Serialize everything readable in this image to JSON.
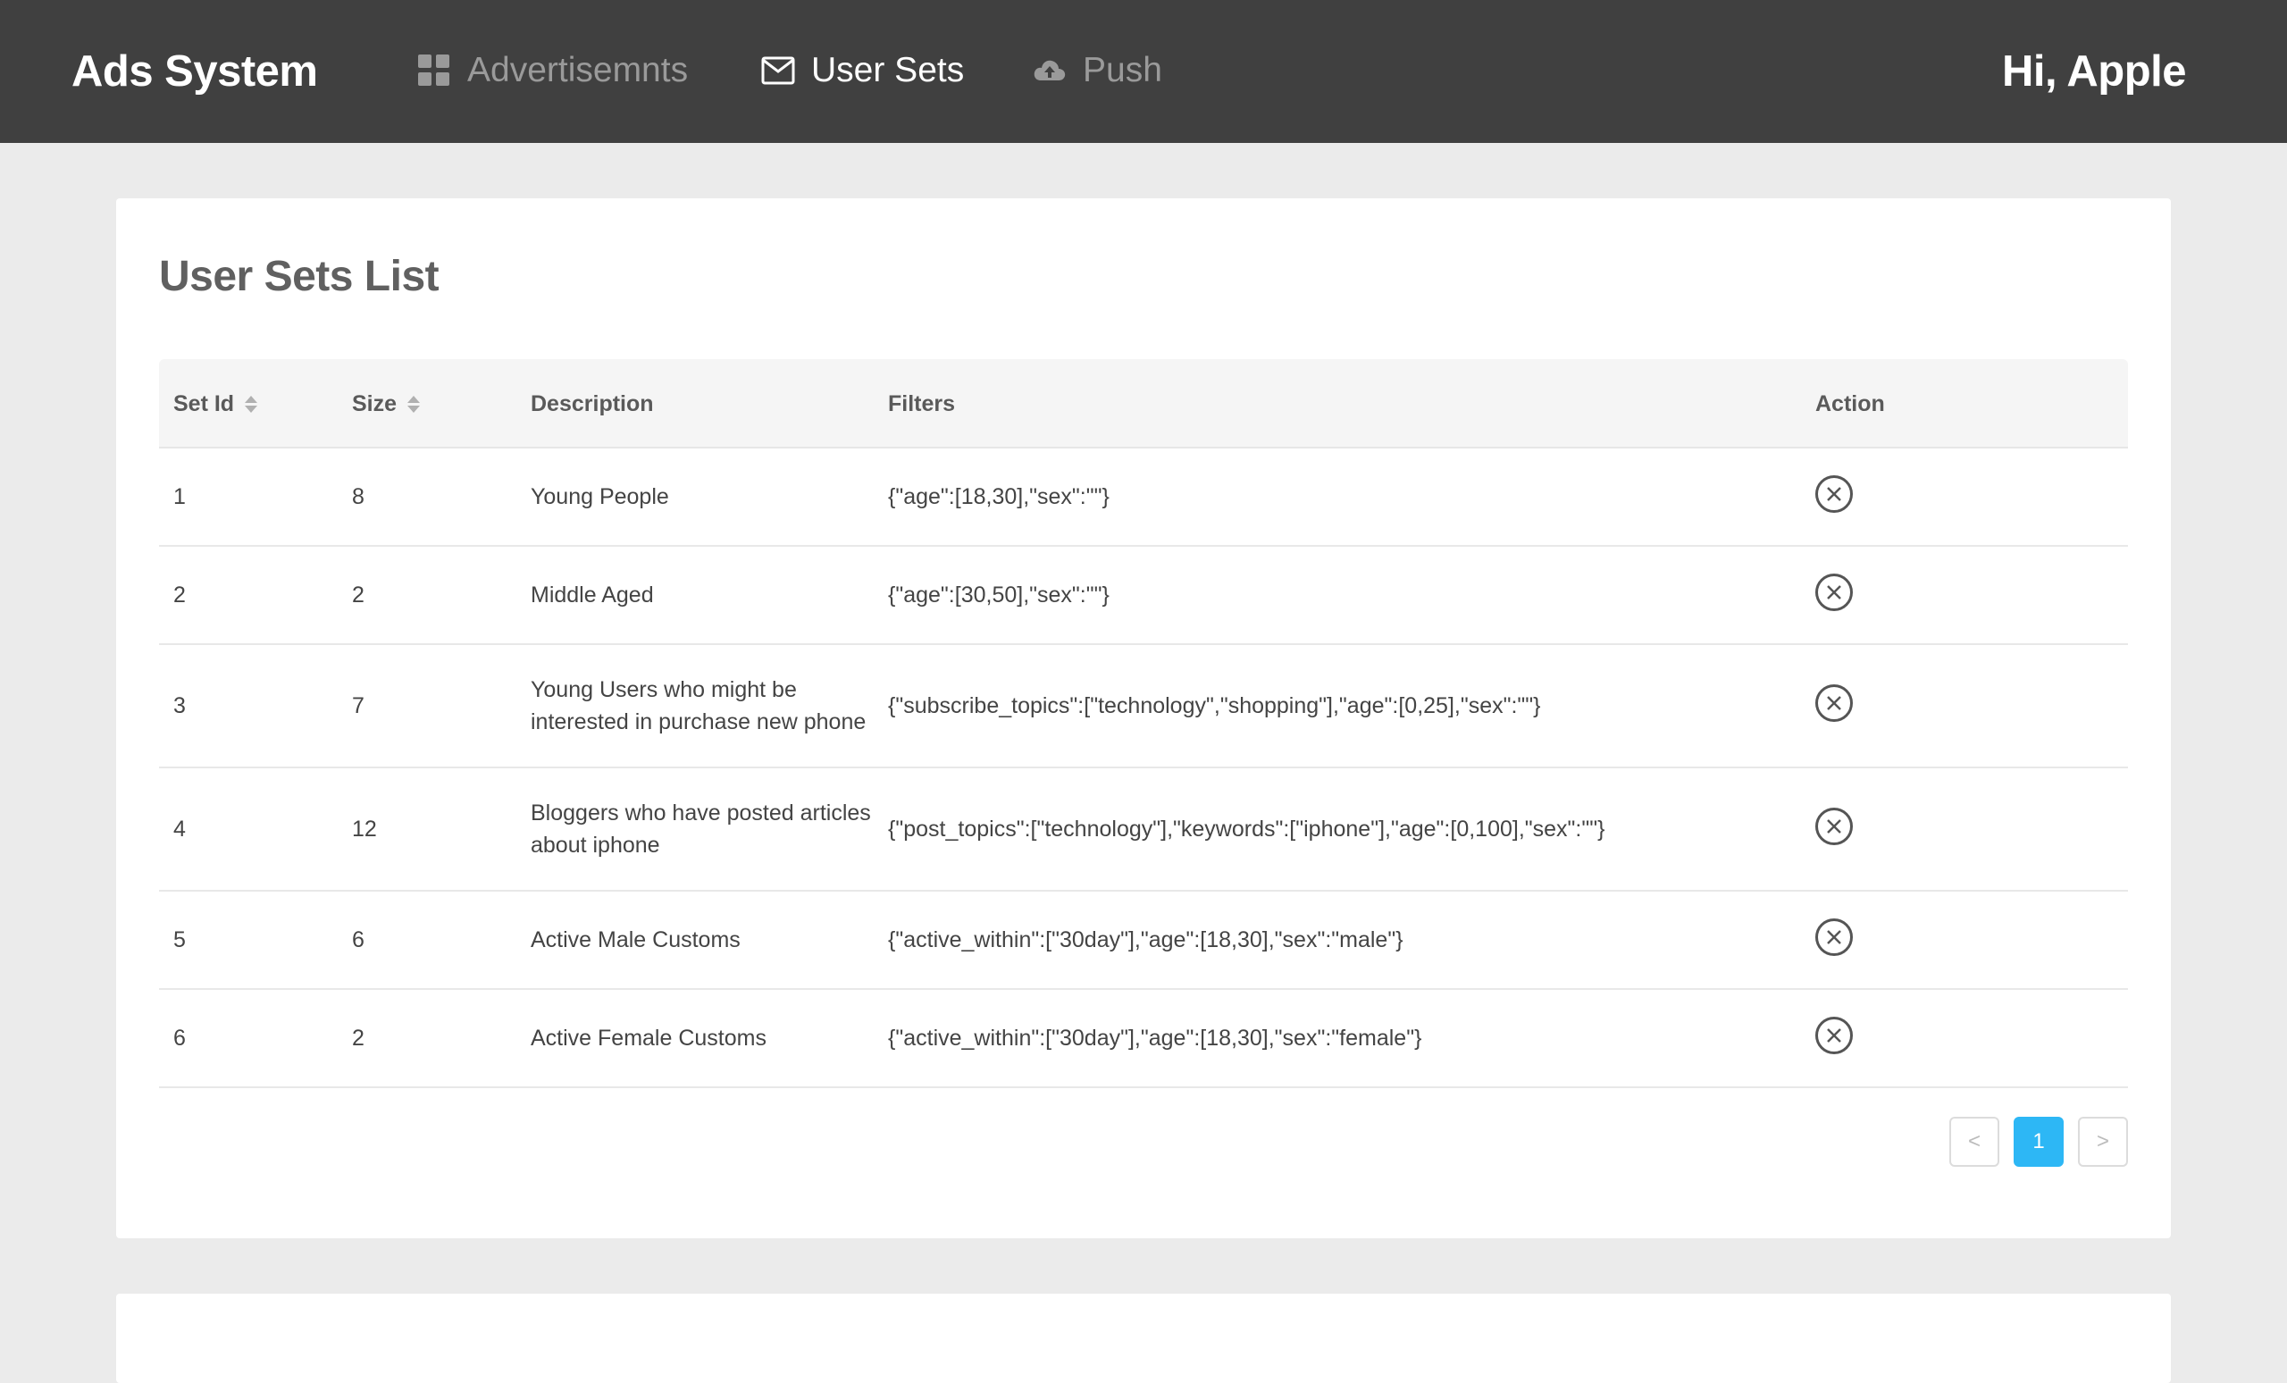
{
  "header": {
    "brand": "Ads System",
    "nav": [
      {
        "label": "Advertisemnts",
        "icon": "dashboard-grid-icon",
        "active": false
      },
      {
        "label": "User Sets",
        "icon": "mail-icon",
        "active": true
      },
      {
        "label": "Push",
        "icon": "cloud-upload-icon",
        "active": false
      }
    ],
    "greeting": "Hi, Apple"
  },
  "main": {
    "title": "User Sets List",
    "columns": {
      "set_id": "Set Id",
      "size": "Size",
      "description": "Description",
      "filters": "Filters",
      "action": "Action"
    },
    "rows": [
      {
        "id": "1",
        "size": "8",
        "description": "Young People",
        "filters": "{\"age\":[18,30],\"sex\":\"\"}"
      },
      {
        "id": "2",
        "size": "2",
        "description": "Middle Aged",
        "filters": "{\"age\":[30,50],\"sex\":\"\"}"
      },
      {
        "id": "3",
        "size": "7",
        "description": "Young Users who might be interested in purchase new phone",
        "filters": "{\"subscribe_topics\":[\"technology\",\"shopping\"],\"age\":[0,25],\"sex\":\"\"}"
      },
      {
        "id": "4",
        "size": "12",
        "description": "Bloggers who have posted articles about iphone",
        "filters": "{\"post_topics\":[\"technology\"],\"keywords\":[\"iphone\"],\"age\":[0,100],\"sex\":\"\"}"
      },
      {
        "id": "5",
        "size": "6",
        "description": "Active Male Customs",
        "filters": "{\"active_within\":[\"30day\"],\"age\":[18,30],\"sex\":\"male\"}"
      },
      {
        "id": "6",
        "size": "2",
        "description": "Active Female Customs",
        "filters": "{\"active_within\":[\"30day\"],\"age\":[18,30],\"sex\":\"female\"}"
      }
    ],
    "pagination": {
      "prev": "<",
      "current": "1",
      "next": ">"
    }
  },
  "colors": {
    "topbar": "#404040",
    "accent": "#2db7f5",
    "background": "#ebebeb"
  }
}
